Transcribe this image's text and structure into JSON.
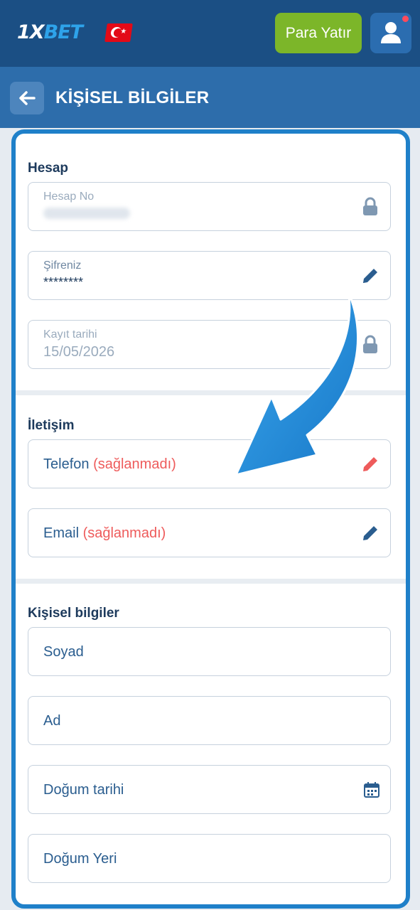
{
  "header": {
    "logo_prefix": "1X",
    "logo_suffix": "BET",
    "deposit_label": "Para Yatır"
  },
  "subheader": {
    "title": "KİŞİSEL BİLGİLER"
  },
  "sections": {
    "account": {
      "title": "Hesap",
      "account_no_label": "Hesap No",
      "password_label": "Şifreniz",
      "password_value": "********",
      "reg_date_label": "Kayıt tarihi",
      "reg_date_value": "15/05/2026"
    },
    "contact": {
      "title": "İletişim",
      "phone_label": "Telefon",
      "phone_status": "(sağlanmadı)",
      "email_label": "Email",
      "email_status": "(sağlanmadı)"
    },
    "personal": {
      "title": "Kişisel bilgiler",
      "surname_label": "Soyad",
      "name_label": "Ad",
      "birth_date_label": "Doğum tarihi",
      "birth_place_label": "Doğum Yeri"
    }
  },
  "colors": {
    "header_bg": "#1b4f84",
    "subheader_bg": "#2d6dab",
    "deposit_bg": "#7cb629",
    "frame_border": "#1f80c9",
    "text_dark": "#1d3a5c",
    "required_red": "#ee5b5b"
  },
  "icons": [
    "back-arrow-icon",
    "user-icon",
    "lock-icon",
    "pencil-icon",
    "calendar-icon",
    "turkey-flag-icon"
  ]
}
